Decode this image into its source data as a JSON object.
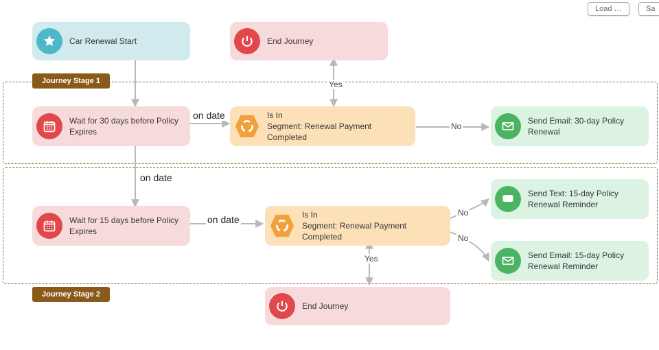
{
  "toolbar": {
    "load": "Load …",
    "save": "Sa"
  },
  "stages": {
    "s1": "Journey Stage 1",
    "s2": "Journey Stage 2"
  },
  "nodes": {
    "start": "Car Renewal Start",
    "end1": "End Journey",
    "wait30": "Wait for 30 days before Policy Expires",
    "segment1_line1": "Is In",
    "segment1_line2": "Segment: Renewal Payment Completed",
    "email30": "Send Email: 30-day Policy Renewal",
    "wait15": "Wait for 15 days before Policy Expires",
    "segment2_line1": "Is In",
    "segment2_line2": "Segment: Renewal Payment Completed",
    "text15": "Send Text: 15-day Policy Renewal Reminder",
    "email15": "Send Email: 15-day Policy Renewal Reminder",
    "end2": "End Journey"
  },
  "edges": {
    "ondate1": "on date",
    "ondate2": "on date",
    "ondate3": "on date",
    "yes1": "Yes",
    "no1": "No",
    "yes2": "Yes",
    "no2a": "No",
    "no2b": "No"
  }
}
